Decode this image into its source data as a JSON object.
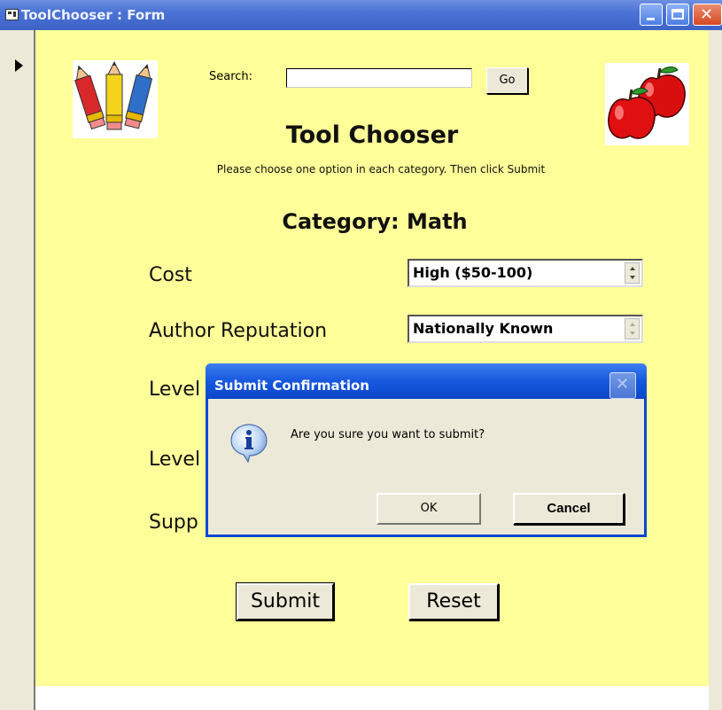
{
  "window": {
    "title": "ToolChooser : Form"
  },
  "search": {
    "label": "Search:",
    "value": "",
    "go_label": "Go"
  },
  "form": {
    "title": "Tool Chooser",
    "instructions": "Please choose one option in each category. Then click Submit",
    "category": "Category: Math",
    "fields": [
      {
        "label": "Cost",
        "value": "High ($50-100)"
      },
      {
        "label": "Author Reputation",
        "value": "Nationally Known"
      },
      {
        "label": "Level"
      },
      {
        "label": "Level"
      },
      {
        "label": "Supp"
      }
    ],
    "submit_label": "Submit",
    "reset_label": "Reset"
  },
  "dialog": {
    "title": "Submit Confirmation",
    "message": "Are you sure you want to submit?",
    "ok_label": "OK",
    "cancel_label": "Cancel"
  },
  "icons": {
    "pencils": "pencils-clipart",
    "apples": "apples-clipart",
    "info": "information-icon"
  },
  "colors": {
    "form_background": "#ffff99",
    "titlebar": "#4b72d6",
    "dialog_titlebar": "#1658df"
  }
}
